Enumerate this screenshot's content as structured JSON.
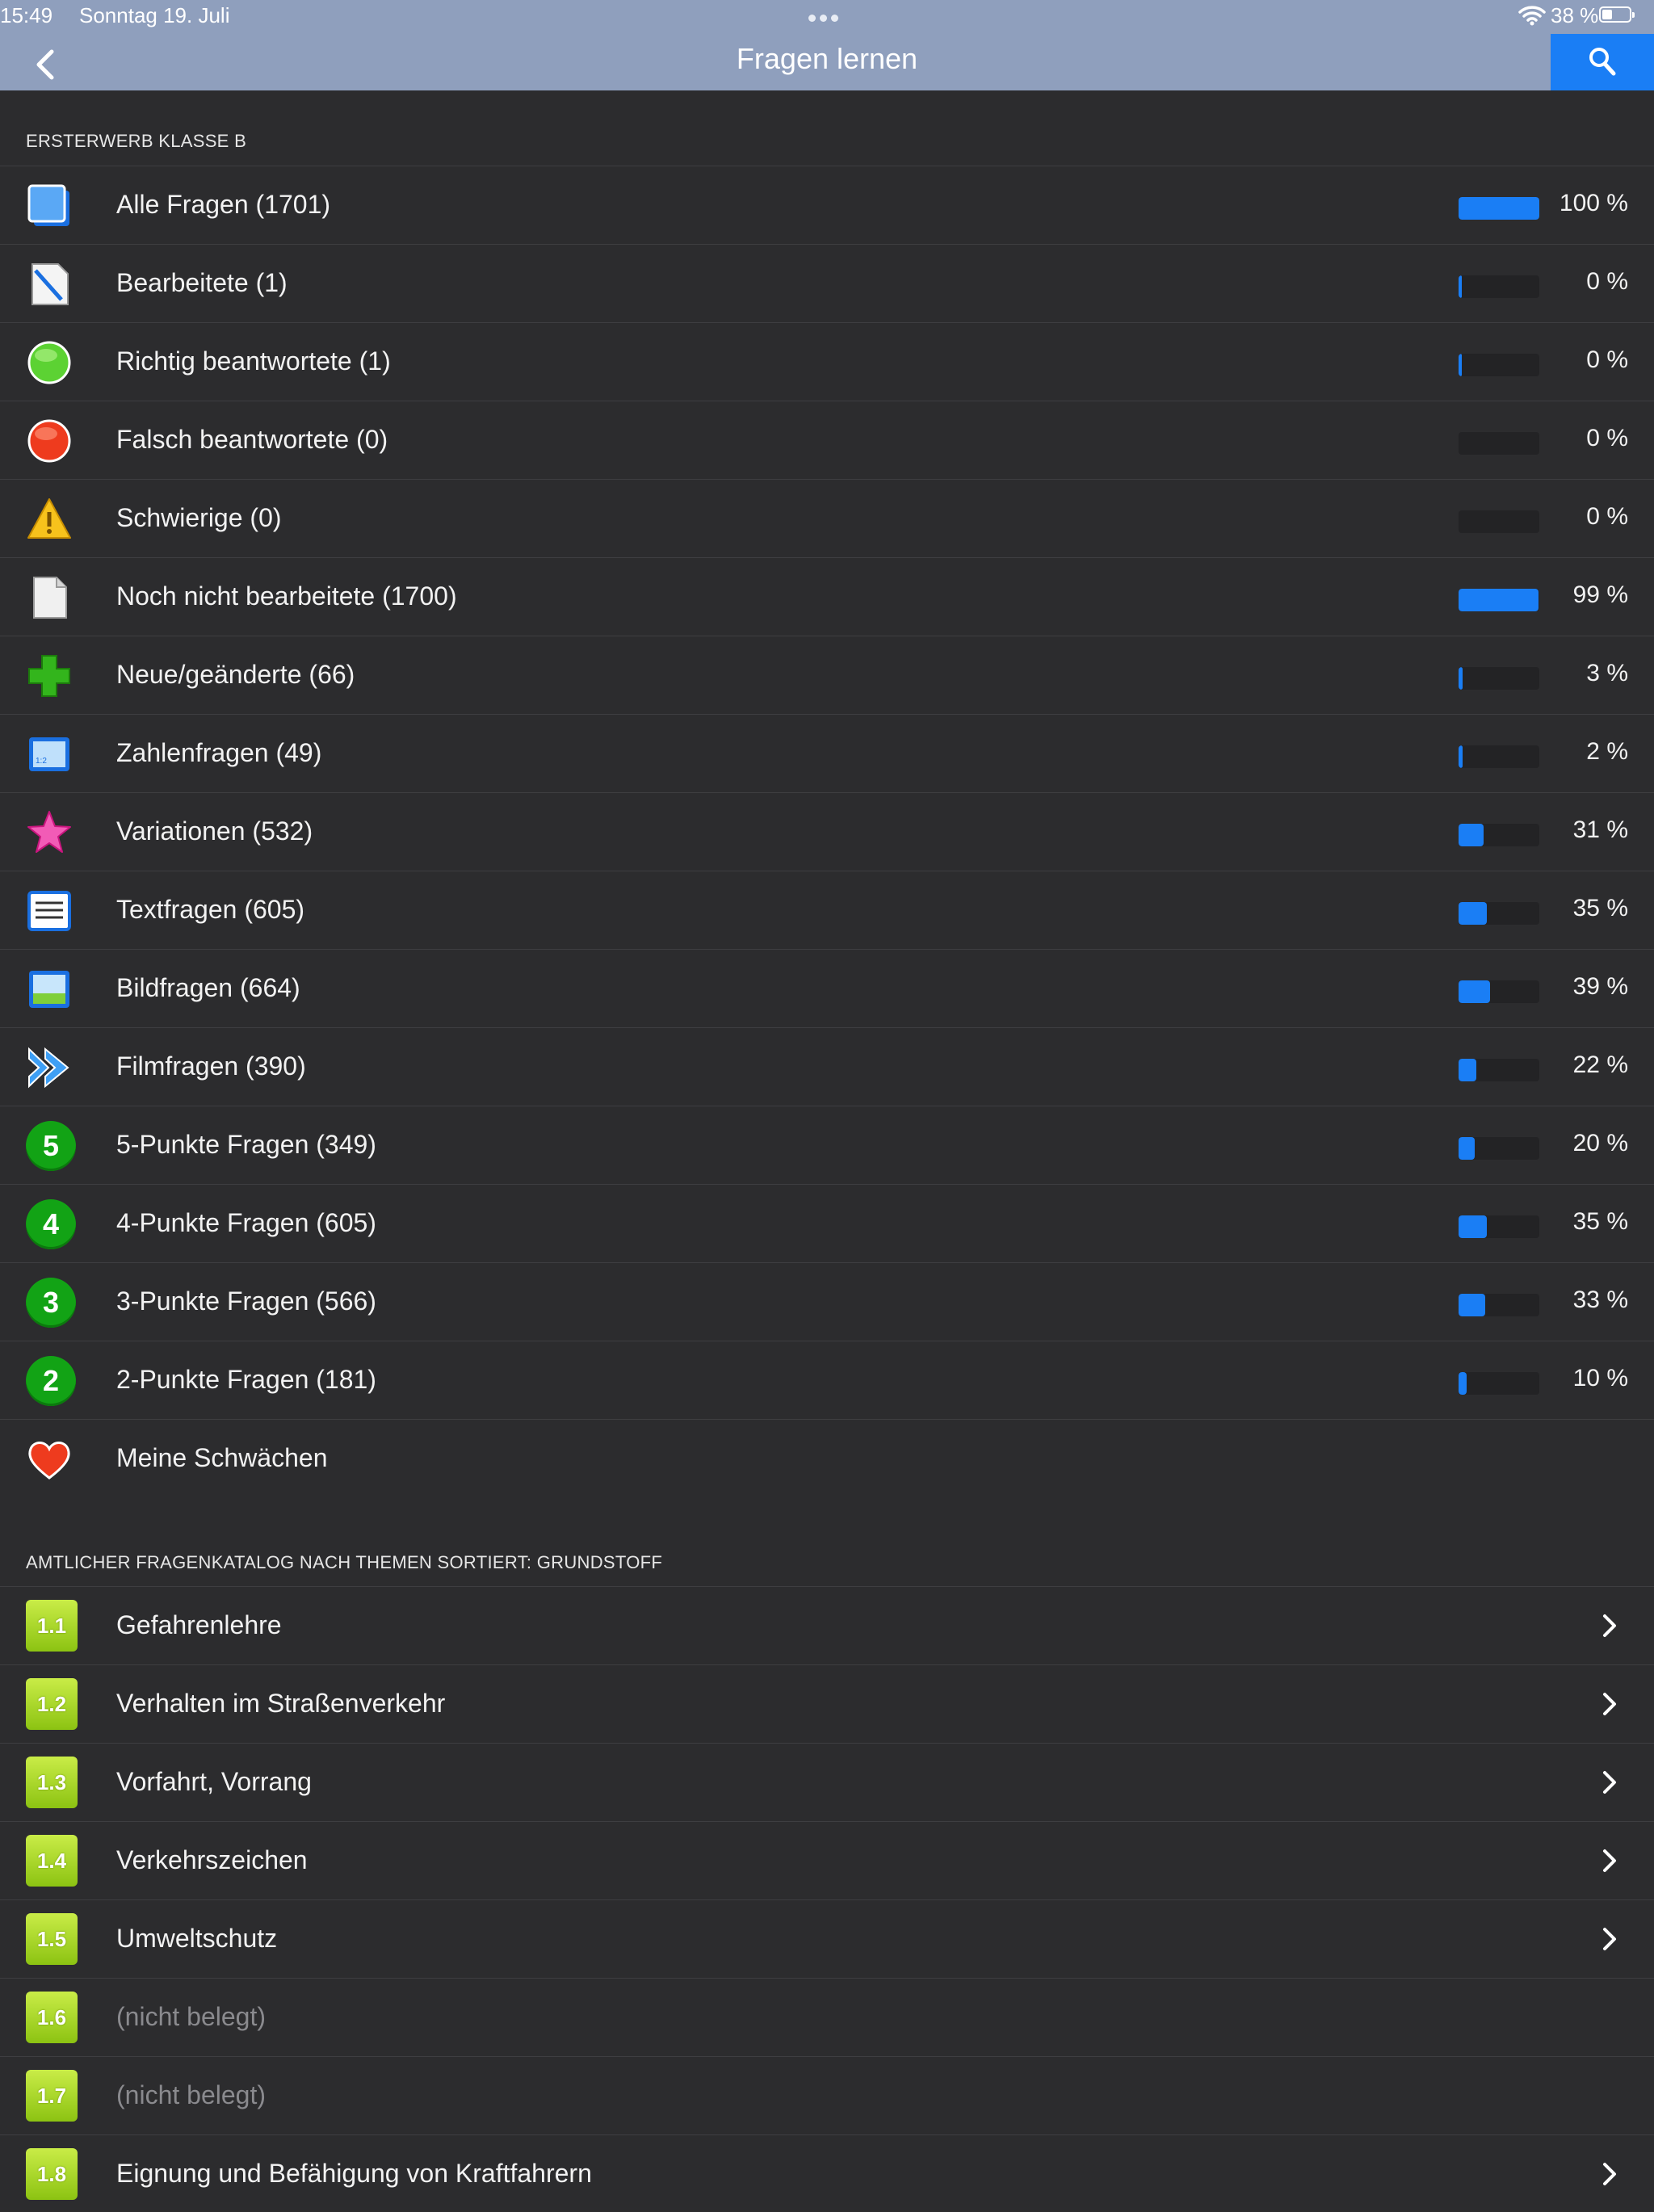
{
  "status": {
    "time": "15:49",
    "date": "Sonntag 19. Juli",
    "battery": "38 %",
    "battery_level": 0.38
  },
  "nav": {
    "title": "Fragen lernen",
    "back_icon": "chevron-left-icon",
    "search_icon": "magnifier-icon"
  },
  "section1": {
    "header": "ERSTERWERB KLASSE B",
    "items": [
      {
        "label": "Alle Fragen (1701)",
        "pct": "100 %",
        "progress": 1.0,
        "icon": "stack-icon"
      },
      {
        "label": "Bearbeitete (1)",
        "pct": "0 %",
        "progress": 0.0,
        "icon": "edited-document-icon"
      },
      {
        "label": "Richtig beantwortete (1)",
        "pct": "0 %",
        "progress": 0.0,
        "icon": "green-circle-icon"
      },
      {
        "label": "Falsch beantwortete (0)",
        "pct": "0 %",
        "progress": 0.0,
        "icon": "red-circle-icon"
      },
      {
        "label": "Schwierige (0)",
        "pct": "0 %",
        "progress": 0.0,
        "icon": "warning-icon"
      },
      {
        "label": "Noch nicht bearbeitete (1700)",
        "pct": "99 %",
        "progress": 0.99,
        "icon": "blank-document-icon"
      },
      {
        "label": "Neue/geänderte (66)",
        "pct": "3 %",
        "progress": 0.03,
        "icon": "green-plus-icon"
      },
      {
        "label": "Zahlenfragen (49)",
        "pct": "2 %",
        "progress": 0.02,
        "icon": "number-window-icon"
      },
      {
        "label": "Variationen (532)",
        "pct": "31 %",
        "progress": 0.31,
        "icon": "pink-star-icon"
      },
      {
        "label": "Textfragen (605)",
        "pct": "35 %",
        "progress": 0.35,
        "icon": "text-lines-icon"
      },
      {
        "label": "Bildfragen (664)",
        "pct": "39 %",
        "progress": 0.39,
        "icon": "picture-icon"
      },
      {
        "label": "Filmfragen (390)",
        "pct": "22 %",
        "progress": 0.22,
        "icon": "fast-forward-icon"
      },
      {
        "label": "5-Punkte Fragen (349)",
        "pct": "20 %",
        "progress": 0.2,
        "icon": "five-points-icon",
        "num": "5"
      },
      {
        "label": "4-Punkte Fragen (605)",
        "pct": "35 %",
        "progress": 0.35,
        "icon": "four-points-icon",
        "num": "4"
      },
      {
        "label": "3-Punkte Fragen (566)",
        "pct": "33 %",
        "progress": 0.33,
        "icon": "three-points-icon",
        "num": "3"
      },
      {
        "label": "2-Punkte Fragen (181)",
        "pct": "10 %",
        "progress": 0.1,
        "icon": "two-points-icon",
        "num": "2"
      },
      {
        "label": "Meine Schwächen",
        "icon": "heart-icon"
      }
    ]
  },
  "section2": {
    "header": "AMTLICHER FRAGENKATALOG NACH THEMEN SORTIERT: GRUNDSTOFF",
    "items": [
      {
        "badge": "1.1",
        "label": "Gefahrenlehre",
        "enabled": true
      },
      {
        "badge": "1.2",
        "label": "Verhalten im Straßenverkehr",
        "enabled": true
      },
      {
        "badge": "1.3",
        "label": "Vorfahrt, Vorrang",
        "enabled": true
      },
      {
        "badge": "1.4",
        "label": "Verkehrszeichen",
        "enabled": true
      },
      {
        "badge": "1.5",
        "label": "Umweltschutz",
        "enabled": true
      },
      {
        "badge": "1.6",
        "label": "(nicht belegt)",
        "enabled": false
      },
      {
        "badge": "1.7",
        "label": "(nicht belegt)",
        "enabled": false
      },
      {
        "badge": "1.8",
        "label": "Eignung und Befähigung von Kraftfahrern",
        "enabled": true
      }
    ]
  }
}
